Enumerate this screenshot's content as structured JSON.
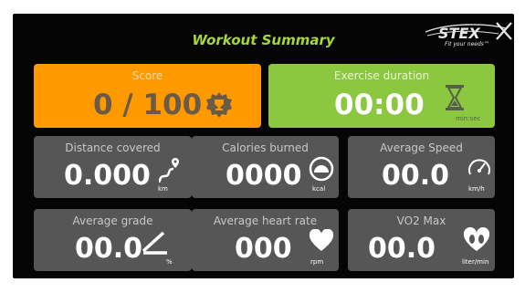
{
  "header": {
    "title": "Workout Summary",
    "brand": "STEX",
    "tagline": "Fit your needs™"
  },
  "score": {
    "label": "Score",
    "value": "0 / 100",
    "icon": "trophy-badge-icon"
  },
  "duration": {
    "label": "Exercise duration",
    "value": "00:00",
    "unit": "min:sec",
    "icon": "hourglass-icon"
  },
  "stats": {
    "distance": {
      "label": "Distance covered",
      "value": "0.000",
      "unit": "km",
      "icon": "route-pin-icon"
    },
    "calories": {
      "label": "Calories burned",
      "value": "0000",
      "unit": "kcal",
      "icon": "scale-gauge-icon"
    },
    "speed": {
      "label": "Average Speed",
      "value": "00.0",
      "unit": "km/h",
      "icon": "speedometer-icon"
    },
    "grade": {
      "label": "Average grade",
      "value": "00.0",
      "unit": "%",
      "icon": "incline-icon"
    },
    "heart_rate": {
      "label": "Average heart rate",
      "value": "000",
      "unit": "rpm",
      "icon": "heart-icon"
    },
    "vo2": {
      "label": "VO2 Max",
      "value": "00.0",
      "unit": "liter/min",
      "icon": "heart-lungs-icon"
    }
  },
  "colors": {
    "score_bg": "#ff9900",
    "duration_bg": "#8cc83f",
    "title": "#a6d63a",
    "card_bg": "#565656",
    "screen_bg": "#050505"
  }
}
